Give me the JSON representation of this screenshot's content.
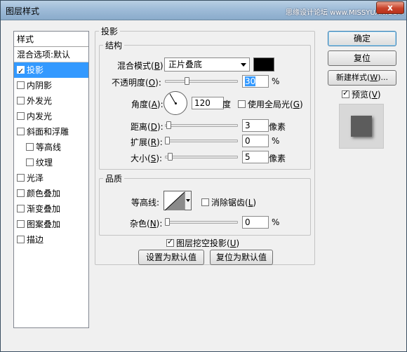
{
  "window": {
    "title": "图层样式",
    "watermark": "思缘设计论坛 www.MISSYUAN.COM",
    "close": "x"
  },
  "stylelist": {
    "header": "样式",
    "blend_options": "混合选项:默认",
    "items": [
      {
        "label": "投影",
        "checked": true,
        "selected": true
      },
      {
        "label": "内阴影",
        "checked": false
      },
      {
        "label": "外发光",
        "checked": false
      },
      {
        "label": "内发光",
        "checked": false
      },
      {
        "label": "斜面和浮雕",
        "checked": false
      },
      {
        "label": "等高线",
        "checked": false,
        "sub": true
      },
      {
        "label": "纹理",
        "checked": false,
        "sub": true
      },
      {
        "label": "光泽",
        "checked": false
      },
      {
        "label": "颜色叠加",
        "checked": false
      },
      {
        "label": "渐变叠加",
        "checked": false
      },
      {
        "label": "图案叠加",
        "checked": false
      },
      {
        "label": "描边",
        "checked": false
      }
    ]
  },
  "shadow": {
    "group_title": "投影",
    "structure": {
      "title": "结构",
      "blend_mode_label": "混合模式(",
      "blend_mode_key": "B",
      "blend_mode_value": "正片叠底",
      "color": "#000000",
      "opacity_label": "不透明度(",
      "opacity_key": "O",
      "opacity_value": "30",
      "opacity_unit": "%",
      "opacity_level": 0.3,
      "angle_label": "角度(",
      "angle_key": "A",
      "angle_value": "120",
      "angle_unit": "度",
      "global_light_label": "使用全局光(",
      "global_light_key": "G",
      "global_light_checked": false,
      "distance_label": "距离(",
      "distance_key": "D",
      "distance_value": "3",
      "distance_unit": "像素",
      "spread_label": "扩展(",
      "spread_key": "R",
      "spread_value": "0",
      "spread_unit": "%",
      "size_label": "大小(",
      "size_key": "S",
      "size_value": "5",
      "size_unit": "像素"
    },
    "quality": {
      "title": "品质",
      "contour_label": "等高线:",
      "antialias_label": "消除锯齿(",
      "antialias_key": "L",
      "antialias_checked": false,
      "noise_label": "杂色(",
      "noise_key": "N",
      "noise_value": "0",
      "noise_unit": "%"
    },
    "knockout_label": "图层挖空投影(",
    "knockout_key": "U",
    "knockout_checked": true,
    "set_default": "设置为默认值",
    "reset_default": "复位为默认值"
  },
  "buttons": {
    "ok": "确定",
    "reset": "复位",
    "new_style": "新建样式(",
    "new_style_key": "W",
    "new_style_tail": ")...",
    "preview_label": "预览(",
    "preview_key": "V",
    "preview_checked": true
  }
}
